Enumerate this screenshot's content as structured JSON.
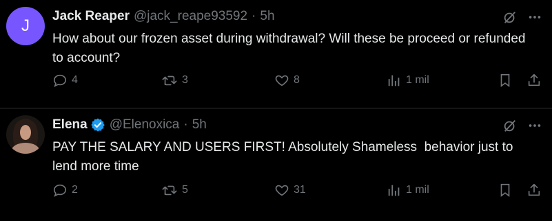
{
  "colors": {
    "background": "#000000",
    "text_primary": "#e7e9ea",
    "text_secondary": "#71767b",
    "divider": "#2f3336",
    "verified_blue": "#1d9bf0",
    "avatar_purple": "#7856ff"
  },
  "tweets": [
    {
      "avatar_letter": "J",
      "name": "Jack Reaper",
      "handle": "@jack_reape93592",
      "separator": "·",
      "time": "5h",
      "text": "How about our frozen asset during withdrawal? Will these be proceed or refunded to account?",
      "replies": "4",
      "retweets": "3",
      "likes": "8",
      "views": "1 mil",
      "icons": [
        "grok-icon",
        "more-icon",
        "reply-icon",
        "retweet-icon",
        "like-icon",
        "views-icon",
        "bookmark-icon",
        "share-icon"
      ]
    },
    {
      "name": "Elena",
      "verified": true,
      "handle": "@Elenoxica",
      "separator": "·",
      "time": "5h",
      "text": "PAY THE SALARY AND USERS FIRST! Absolutely Shameless  behavior just to lend more time",
      "replies": "2",
      "retweets": "5",
      "likes": "31",
      "views": "1 mil",
      "icons": [
        "grok-icon",
        "more-icon",
        "reply-icon",
        "retweet-icon",
        "like-icon",
        "views-icon",
        "bookmark-icon",
        "share-icon"
      ]
    }
  ]
}
